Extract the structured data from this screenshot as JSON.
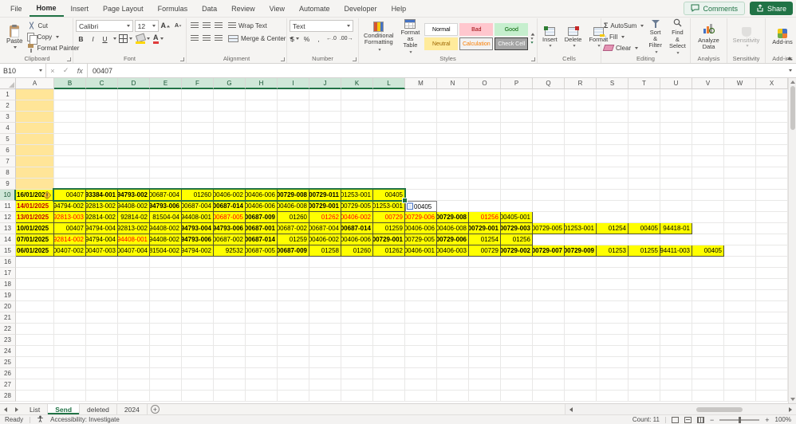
{
  "tabbar": {
    "tabs": [
      {
        "label": "File",
        "active": false
      },
      {
        "label": "Home",
        "active": true
      },
      {
        "label": "Insert",
        "active": false
      },
      {
        "label": "Page Layout",
        "active": false
      },
      {
        "label": "Formulas",
        "active": false
      },
      {
        "label": "Data",
        "active": false
      },
      {
        "label": "Review",
        "active": false
      },
      {
        "label": "View",
        "active": false
      },
      {
        "label": "Automate",
        "active": false
      },
      {
        "label": "Developer",
        "active": false
      },
      {
        "label": "Help",
        "active": false
      }
    ],
    "comments_label": "Comments",
    "share_label": "Share"
  },
  "ribbon": {
    "clipboard": {
      "group": "Clipboard",
      "paste": "Paste",
      "cut": "Cut",
      "copy": "Copy",
      "format_painter": "Format Painter"
    },
    "font": {
      "group": "Font",
      "name": "Calibri",
      "size": "12"
    },
    "alignment": {
      "group": "Alignment",
      "wrap": "Wrap Text",
      "merge": "Merge & Center"
    },
    "number": {
      "group": "Number",
      "format": "Text"
    },
    "styles": {
      "group": "Styles",
      "conditional_1": "Conditional",
      "conditional_2": "Formatting",
      "format_table_1": "Format as",
      "format_table_2": "Table",
      "cells": [
        {
          "label": "Normal",
          "bg": "#ffffff",
          "fg": "#000000",
          "border": "#d5d5d5"
        },
        {
          "label": "Bad",
          "bg": "#ffc7ce",
          "fg": "#9c0006",
          "border": "#ffc7ce"
        },
        {
          "label": "Good",
          "bg": "#c6efce",
          "fg": "#006100",
          "border": "#c6efce"
        },
        {
          "label": "Neutral",
          "bg": "#ffeb9c",
          "fg": "#9c6500",
          "border": "#ffeb9c"
        },
        {
          "label": "Calculation",
          "bg": "#f2f2f2",
          "fg": "#fa7d00",
          "border": "#7f7f7f"
        },
        {
          "label": "Check Cell",
          "bg": "#a5a5a5",
          "fg": "#ffffff",
          "border": "#3f3f3f"
        }
      ]
    },
    "cells": {
      "group": "Cells",
      "insert": "Insert",
      "delete": "Delete",
      "format": "Format"
    },
    "editing": {
      "group": "Editing",
      "autosum": "AutoSum",
      "fill": "Fill",
      "clear": "Clear",
      "sort_1": "Sort &",
      "sort_2": "Filter",
      "find_1": "Find &",
      "find_2": "Select"
    },
    "analysis": {
      "group": "Analysis",
      "analyze_1": "Analyze",
      "analyze_2": "Data"
    },
    "sensitivity": {
      "group": "Sensitivity",
      "label": "Sensitivity"
    },
    "addins": {
      "group": "Add-ins",
      "label": "Add-ins"
    }
  },
  "glyphs": {
    "bold": "B",
    "italic": "I",
    "underline": "U",
    "font_color": "A",
    "grow_font": "A",
    "shrink_font": "A",
    "currency": "$",
    "percent": "%",
    "comma": ",",
    "inc_decimal": "←.0",
    "dec_decimal": ".00→",
    "autosum": "Σ",
    "fill_arrow": "↓",
    "fx": "fx",
    "cancel": "×",
    "enter": "✓",
    "add": "+",
    "zoom_out": "−",
    "zoom_in": "+"
  },
  "formula_bar": {
    "name_box": "B10",
    "value": "00407"
  },
  "grid": {
    "columns": [
      "A",
      "B",
      "C",
      "D",
      "E",
      "F",
      "G",
      "H",
      "I",
      "J",
      "K",
      "L",
      "M",
      "N",
      "O",
      "P",
      "Q",
      "R",
      "S",
      "T",
      "U",
      "V",
      "W",
      "X"
    ],
    "row_count": 28,
    "selection": {
      "from_col": "B",
      "to_col": "L",
      "row": 10,
      "active_cell": "B10"
    },
    "colA_highlight_rows": [
      1,
      2,
      3,
      4,
      5,
      6,
      7,
      8,
      9
    ],
    "rows": [
      {
        "row": 10,
        "date": "16/01/2025",
        "date_red": false,
        "warning": true,
        "cells": [
          [
            "00407",
            "n"
          ],
          [
            "93384-001",
            "b"
          ],
          [
            "94793-002",
            "b"
          ],
          [
            "00687-004",
            "n"
          ],
          [
            "01260",
            "n"
          ],
          [
            "00406-002",
            "n"
          ],
          [
            "00406-006",
            "n"
          ],
          [
            "00729-008",
            "b"
          ],
          [
            "00729-011",
            "b"
          ],
          [
            "01253-001",
            "n"
          ],
          [
            "00405",
            "n"
          ]
        ]
      },
      {
        "row": 11,
        "date": "14/01/2025",
        "date_red": true,
        "warning": false,
        "cells": [
          [
            "94794-002",
            "n"
          ],
          [
            "92813-002",
            "n"
          ],
          [
            "94408-002",
            "n"
          ],
          [
            "94793-006",
            "b"
          ],
          [
            "00687-004",
            "n"
          ],
          [
            "00687-014",
            "b"
          ],
          [
            "00406-006",
            "n"
          ],
          [
            "00406-008",
            "n"
          ],
          [
            "00729-001",
            "b"
          ],
          [
            "00729-005",
            "n"
          ],
          [
            "01253-001",
            "n"
          ]
        ],
        "paste_cell": "00405"
      },
      {
        "row": 12,
        "date": "13/01/2025",
        "date_red": true,
        "warning": false,
        "cells": [
          [
            "92813-003",
            "r"
          ],
          [
            "92814-002",
            "n"
          ],
          [
            "92814-02",
            "n"
          ],
          [
            "81504-04",
            "n"
          ],
          [
            "94408-001",
            "n"
          ],
          [
            "00687-005",
            "r"
          ],
          [
            "00687-009",
            "b"
          ],
          [
            "01260",
            "n"
          ],
          [
            "01262",
            "r"
          ],
          [
            "00406-002",
            "r"
          ],
          [
            "00729",
            "r"
          ],
          [
            "00729-006",
            "r"
          ],
          [
            "00729-008",
            "b"
          ],
          [
            "01256",
            "r"
          ],
          [
            "00405-001",
            "n"
          ]
        ]
      },
      {
        "row": 13,
        "date": "10/01/2025",
        "date_red": false,
        "warning": false,
        "cells": [
          [
            "00407",
            "n"
          ],
          [
            "94794-004",
            "n"
          ],
          [
            "92813-002",
            "n"
          ],
          [
            "94408-002",
            "n"
          ],
          [
            "94793-004",
            "b"
          ],
          [
            "94793-006",
            "b"
          ],
          [
            "00687-001",
            "b"
          ],
          [
            "00687-002",
            "n"
          ],
          [
            "00687-004",
            "n"
          ],
          [
            "00687-014",
            "b"
          ],
          [
            "01259",
            "n"
          ],
          [
            "00406-006",
            "n"
          ],
          [
            "00406-008",
            "n"
          ],
          [
            "00729-001",
            "b"
          ],
          [
            "00729-003",
            "b"
          ],
          [
            "00729-005",
            "n"
          ],
          [
            "01253-001",
            "n"
          ],
          [
            "01254",
            "n"
          ],
          [
            "00405",
            "n"
          ],
          [
            "94418-01",
            "n"
          ]
        ]
      },
      {
        "row": 14,
        "date": "07/01/2025",
        "date_red": false,
        "warning": false,
        "cells": [
          [
            "92814-002",
            "r"
          ],
          [
            "94794-004",
            "n"
          ],
          [
            "94408-001",
            "r"
          ],
          [
            "94408-002",
            "n"
          ],
          [
            "94793-006",
            "b"
          ],
          [
            "00687-002",
            "n"
          ],
          [
            "00687-014",
            "b"
          ],
          [
            "01259",
            "n"
          ],
          [
            "00406-002",
            "n"
          ],
          [
            "00406-006",
            "n"
          ],
          [
            "00729-001",
            "b"
          ],
          [
            "00729-005",
            "n"
          ],
          [
            "00729-006",
            "b"
          ],
          [
            "01254",
            "n"
          ],
          [
            "01256",
            "n"
          ]
        ]
      },
      {
        "row": 15,
        "date": "06/01/2025",
        "date_red": false,
        "warning": false,
        "cells": [
          [
            "00407-002",
            "n"
          ],
          [
            "00407-003",
            "n"
          ],
          [
            "00407-004",
            "n"
          ],
          [
            "81504-002",
            "n"
          ],
          [
            "94794-002",
            "n"
          ],
          [
            "92532",
            "n"
          ],
          [
            "00687-005",
            "n"
          ],
          [
            "00687-009",
            "b"
          ],
          [
            "01258",
            "n"
          ],
          [
            "01260",
            "n"
          ],
          [
            "01262",
            "n"
          ],
          [
            "00406-001",
            "n"
          ],
          [
            "00406-003",
            "n"
          ],
          [
            "00729",
            "n"
          ],
          [
            "00729-002",
            "b"
          ],
          [
            "00729-007",
            "b"
          ],
          [
            "00729-009",
            "b"
          ],
          [
            "01253",
            "n"
          ],
          [
            "01255",
            "n"
          ],
          [
            "94411-003",
            "n"
          ],
          [
            "00405",
            "n"
          ]
        ]
      }
    ]
  },
  "sheet_tabs": {
    "tabs": [
      {
        "label": "List",
        "active": false
      },
      {
        "label": "Send",
        "active": true
      },
      {
        "label": "deleted",
        "active": false
      },
      {
        "label": "2024",
        "active": false
      }
    ]
  },
  "status_bar": {
    "mode": "Ready",
    "accessibility": "Accessibility: Investigate",
    "count": "Count: 11",
    "zoom": "100%"
  }
}
